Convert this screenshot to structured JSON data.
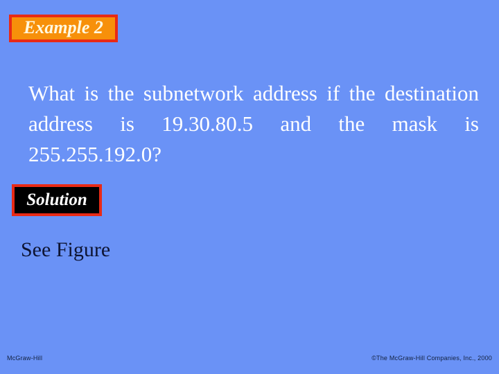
{
  "slide": {
    "background_color": "#6a92f6",
    "title_banner": {
      "label": "Example 2",
      "background_color": "#f7900a",
      "border_color": "#e82a16",
      "text_color": "#fff8e0"
    },
    "question": {
      "text": "What is the subnetwork address if the destination address is 19.30.80.5 and the mask is 255.255.192.0?",
      "text_color": "#ffffff"
    },
    "solution_banner": {
      "label": "Solution",
      "background_color": "#000000",
      "border_color": "#e82a16",
      "text_color": "#ffffff"
    },
    "solution_body": {
      "text": "See Figure",
      "text_color": "#0d1433"
    },
    "footer": {
      "left": "McGraw-Hill",
      "right": "©The McGraw-Hill Companies, Inc., 2000"
    }
  }
}
